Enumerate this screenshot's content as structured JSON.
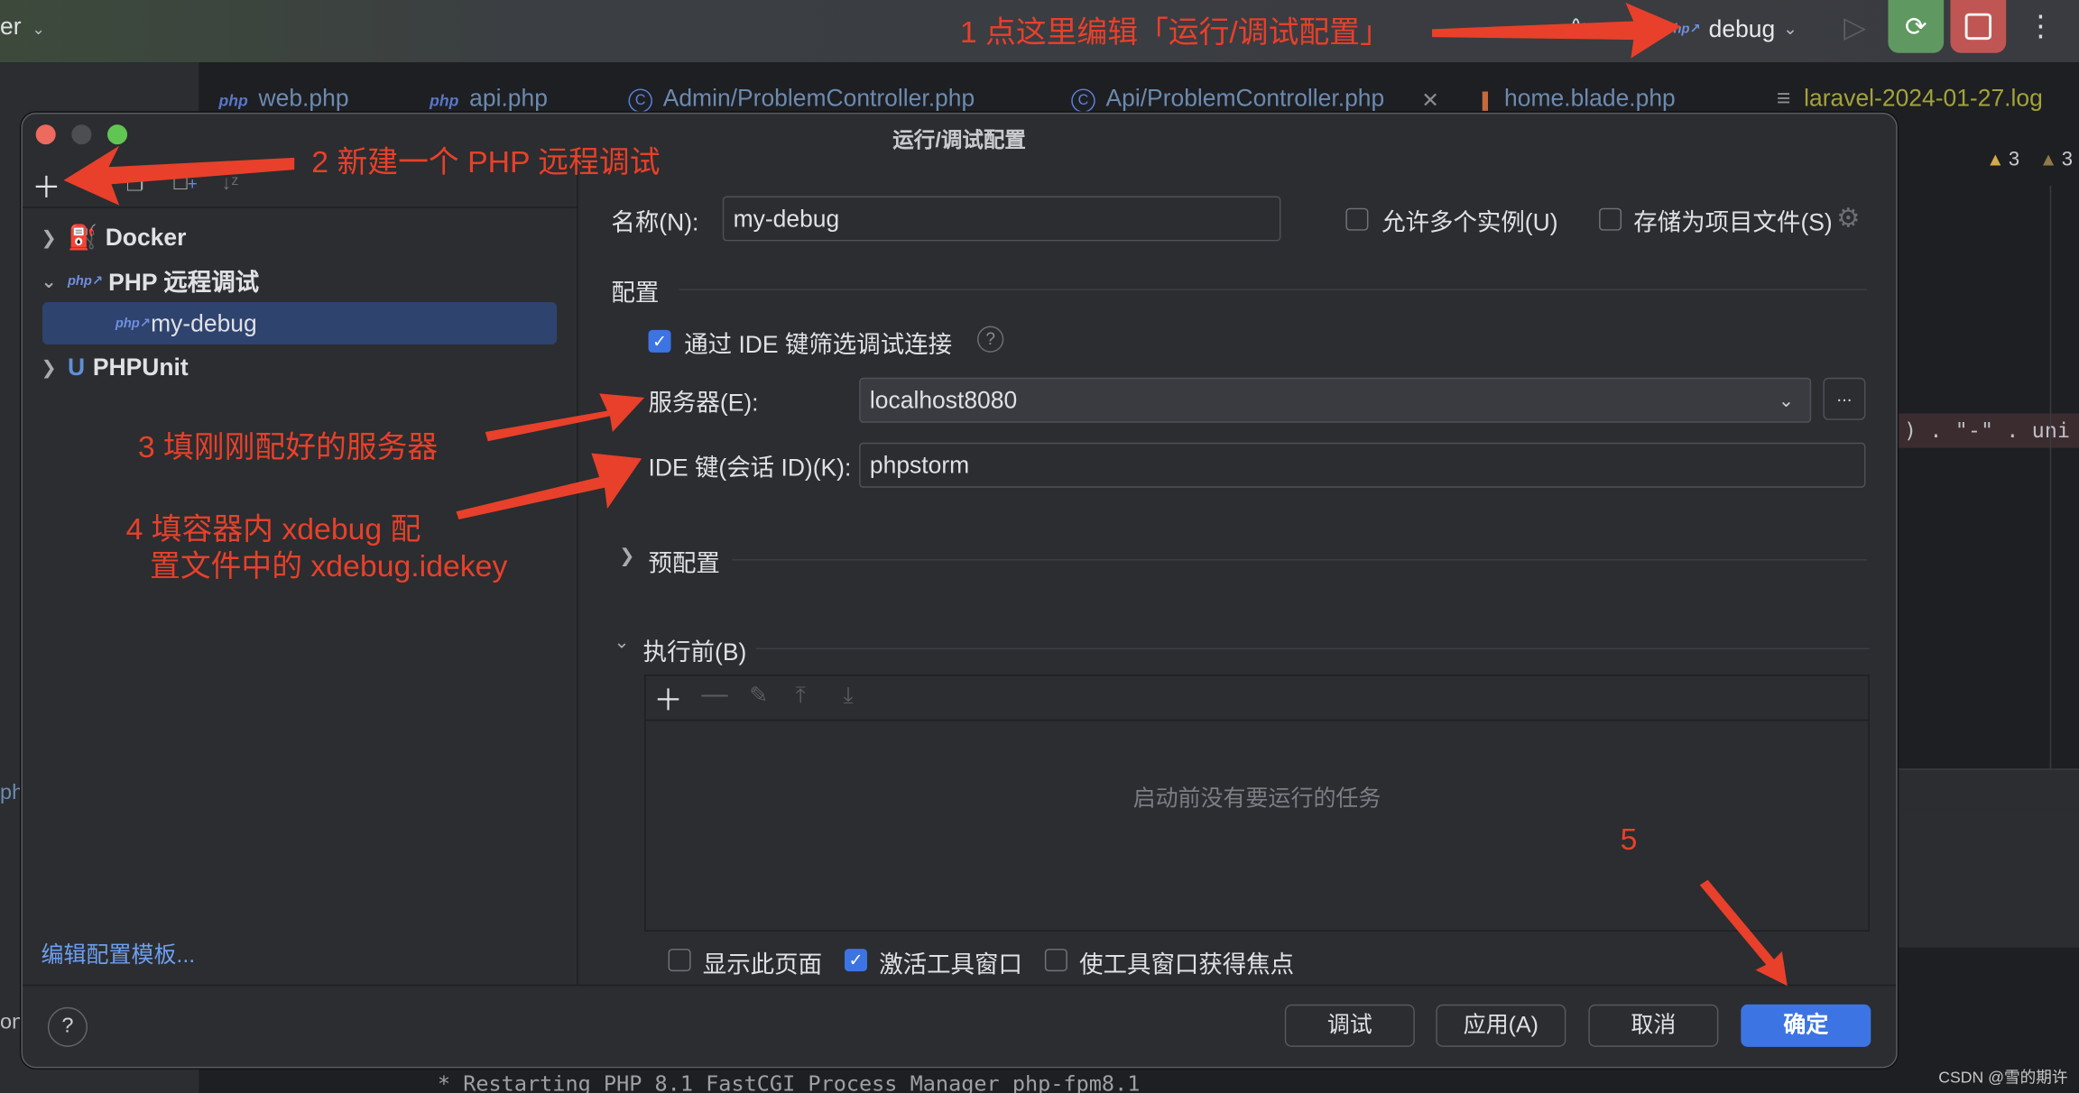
{
  "topbar": {
    "project_label": "er",
    "run_config": "debug",
    "icons": [
      "signal-icon",
      "php-remote-debug-icon",
      "chevron-down-icon",
      "play-icon",
      "rerun-debug-icon",
      "stop-icon",
      "more-vertical-icon"
    ],
    "colors": {
      "rerun": "#5f9860",
      "stop": "#c05653"
    }
  },
  "editor_tabs": [
    {
      "icon": "php",
      "label": "web.php"
    },
    {
      "icon": "php",
      "label": "api.php"
    },
    {
      "icon": "class",
      "label": "Admin/ProblemController.php"
    },
    {
      "icon": "class",
      "label": "Api/ProblemController.php",
      "closable": true
    },
    {
      "icon": "blade",
      "label": "home.blade.php"
    },
    {
      "icon": "log",
      "label": "laravel-2024-01-27.log"
    }
  ],
  "editor": {
    "warnings": [
      "3",
      "3"
    ],
    "code_fragment": ") . \"-\" . uni",
    "terminal_line": "* Restarting PHP 8.1 FastCGI Process Manager php-fpm8.1",
    "left_fragment_1": "ph",
    "left_fragment_2": "on"
  },
  "dialog": {
    "title": "运行/调试配置",
    "tree": [
      {
        "label": "Docker",
        "expanded": false,
        "icon": "docker-icon"
      },
      {
        "label": "PHP 远程调试",
        "expanded": true,
        "icon": "php-remote-debug-icon",
        "children": [
          {
            "label": "my-debug",
            "selected": true
          }
        ]
      },
      {
        "label": "PHPUnit",
        "expanded": false,
        "icon": "phpunit-icon"
      }
    ],
    "edit_templates_link": "编辑配置模板...",
    "name_label": "名称(N):",
    "name_value": "my-debug",
    "allow_multiple_label": "允许多个实例(U)",
    "allow_multiple_checked": false,
    "store_as_file_label": "存储为项目文件(S)",
    "store_as_file_checked": false,
    "config_section": "配置",
    "filter_by_ide_key_label": "通过 IDE 键筛选调试连接",
    "filter_by_ide_key_checked": true,
    "server_label": "服务器(E):",
    "server_value": "localhost8080",
    "browse_label": "...",
    "ide_key_label": "IDE 键(会话 ID)(K):",
    "ide_key_value": "phpstorm",
    "preconfig_section": "预配置",
    "before_launch_section": "执行前(B)",
    "before_launch_empty": "启动前没有要运行的任务",
    "show_page_label": "显示此页面",
    "show_page_checked": false,
    "activate_tool_window_label": "激活工具窗口",
    "activate_tool_window_checked": true,
    "focus_tool_window_label": "使工具窗口获得焦点",
    "focus_tool_window_checked": false,
    "buttons": {
      "debug": "调试",
      "apply": "应用(A)",
      "cancel": "取消",
      "ok": "确定"
    },
    "help": "?"
  },
  "annotations": {
    "step1": "1 点这里编辑「运行/调试配置」",
    "step2": "2 新建一个 PHP 远程调试",
    "step3": "3 填刚刚配好的服务器",
    "step4_line1": "4 填容器内 xdebug 配",
    "step4_line2": "置文件中的 xdebug.idekey",
    "step5": "5",
    "color": "#e8402a"
  },
  "watermark": "CSDN @雪的期许"
}
